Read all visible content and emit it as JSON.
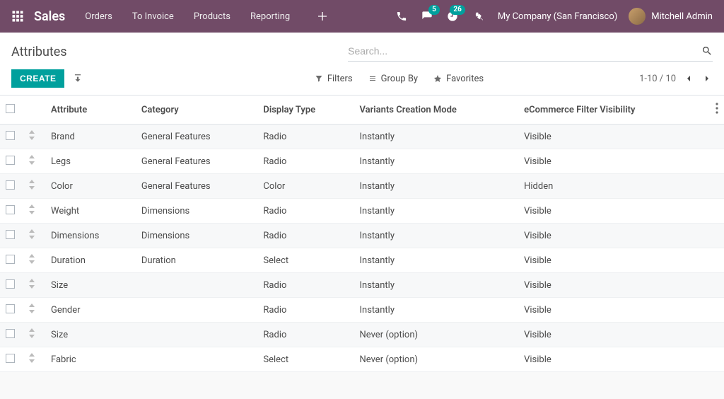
{
  "navbar": {
    "brand": "Sales",
    "items": [
      "Orders",
      "To Invoice",
      "Products",
      "Reporting"
    ],
    "msg_badge": "5",
    "activity_badge": "26",
    "company": "My Company (San Francisco)",
    "user": "Mitchell Admin"
  },
  "page": {
    "title": "Attributes",
    "create_label": "CREATE",
    "search_placeholder": "Search..."
  },
  "filters": {
    "filters": "Filters",
    "groupby": "Group By",
    "favorites": "Favorites"
  },
  "pager": {
    "range": "1-10 / 10"
  },
  "columns": {
    "attribute": "Attribute",
    "category": "Category",
    "display_type": "Display Type",
    "variants_mode": "Variants Creation Mode",
    "ecom_filter": "eCommerce Filter Visibility"
  },
  "rows": [
    {
      "attribute": "Brand",
      "category": "General Features",
      "display_type": "Radio",
      "variants_mode": "Instantly",
      "ecom_filter": "Visible"
    },
    {
      "attribute": "Legs",
      "category": "General Features",
      "display_type": "Radio",
      "variants_mode": "Instantly",
      "ecom_filter": "Visible"
    },
    {
      "attribute": "Color",
      "category": "General Features",
      "display_type": "Color",
      "variants_mode": "Instantly",
      "ecom_filter": "Hidden"
    },
    {
      "attribute": "Weight",
      "category": "Dimensions",
      "display_type": "Radio",
      "variants_mode": "Instantly",
      "ecom_filter": "Visible"
    },
    {
      "attribute": "Dimensions",
      "category": "Dimensions",
      "display_type": "Radio",
      "variants_mode": "Instantly",
      "ecom_filter": "Visible"
    },
    {
      "attribute": "Duration",
      "category": "Duration",
      "display_type": "Select",
      "variants_mode": "Instantly",
      "ecom_filter": "Visible"
    },
    {
      "attribute": "Size",
      "category": "",
      "display_type": "Radio",
      "variants_mode": "Instantly",
      "ecom_filter": "Visible"
    },
    {
      "attribute": "Gender",
      "category": "",
      "display_type": "Radio",
      "variants_mode": "Instantly",
      "ecom_filter": "Visible"
    },
    {
      "attribute": "Size",
      "category": "",
      "display_type": "Radio",
      "variants_mode": "Never (option)",
      "ecom_filter": "Visible"
    },
    {
      "attribute": "Fabric",
      "category": "",
      "display_type": "Select",
      "variants_mode": "Never (option)",
      "ecom_filter": "Visible"
    }
  ]
}
